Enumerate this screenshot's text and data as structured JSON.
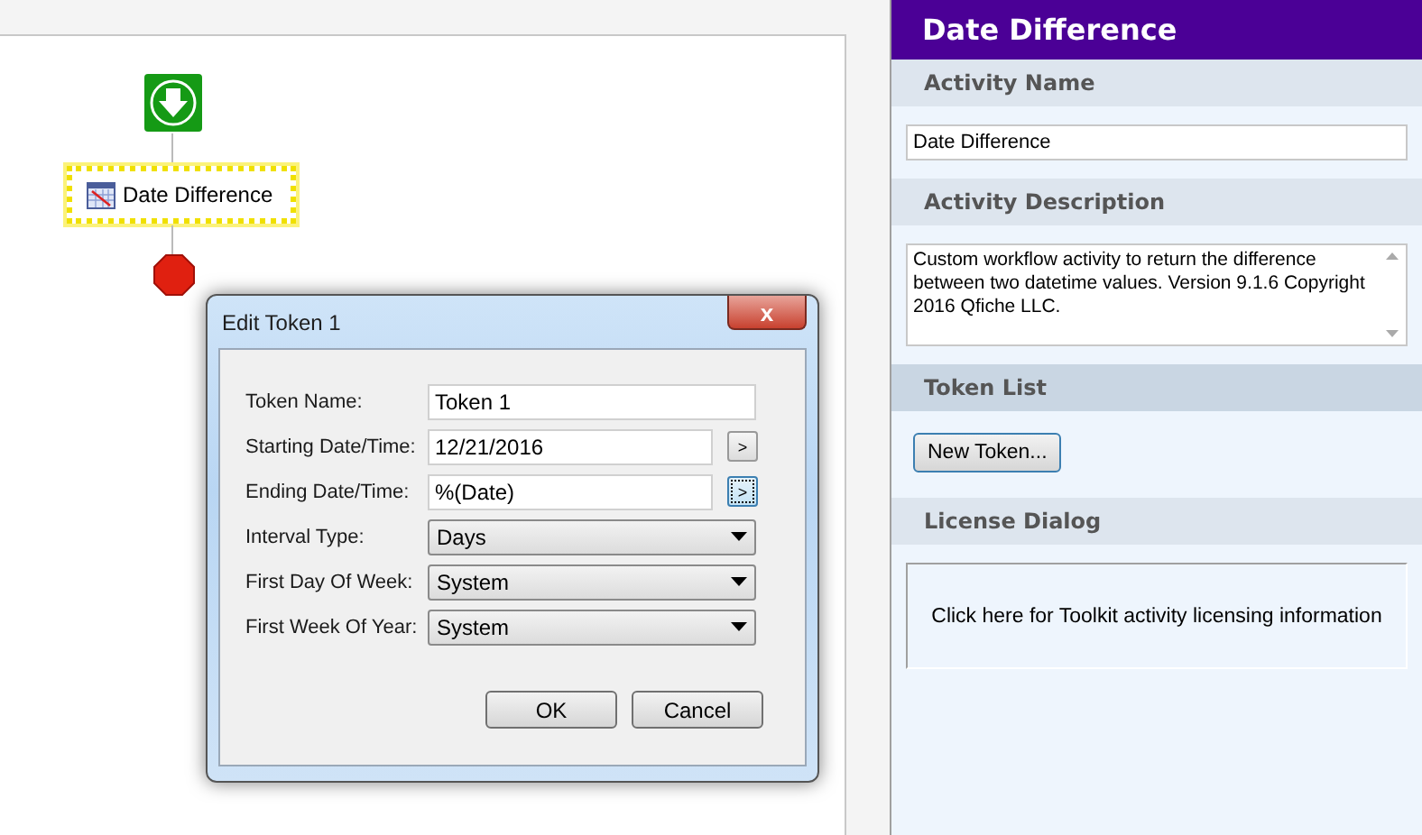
{
  "canvas": {
    "nodes": [
      {
        "kind": "start"
      },
      {
        "kind": "activity",
        "label": "Date Difference",
        "selected": true
      },
      {
        "kind": "stop"
      }
    ]
  },
  "dialog": {
    "title": "Edit Token 1",
    "close": "x",
    "fields": [
      {
        "kind": "text",
        "label": "Token Name:",
        "value": "Token 1"
      },
      {
        "kind": "text-button",
        "label": "Starting Date/Time:",
        "value": "12/21/2016",
        "button": ">",
        "focused": false
      },
      {
        "kind": "text-button",
        "label": "Ending Date/Time:",
        "value": "%(Date)",
        "button": ">",
        "focused": true
      },
      {
        "kind": "select",
        "label": "Interval Type:",
        "value": "Days"
      },
      {
        "kind": "select",
        "label": "First Day Of Week:",
        "value": "System"
      },
      {
        "kind": "select",
        "label": "First Week Of Year:",
        "value": "System"
      }
    ],
    "buttons": [
      "OK",
      "Cancel"
    ]
  },
  "panel": {
    "title": "Date Difference",
    "sections": [
      {
        "kind": "input",
        "title": "Activity Name",
        "value": "Date Difference"
      },
      {
        "kind": "textarea",
        "title": "Activity Description",
        "value": "Custom workflow activity to return the difference between two datetime values.  Version 9.1.6 Copyright 2016 Qfiche LLC."
      },
      {
        "kind": "button",
        "title": "Token List",
        "button": "New Token..."
      },
      {
        "kind": "link-box",
        "title": "License Dialog",
        "text": "Click here for Toolkit activity licensing information"
      }
    ]
  }
}
